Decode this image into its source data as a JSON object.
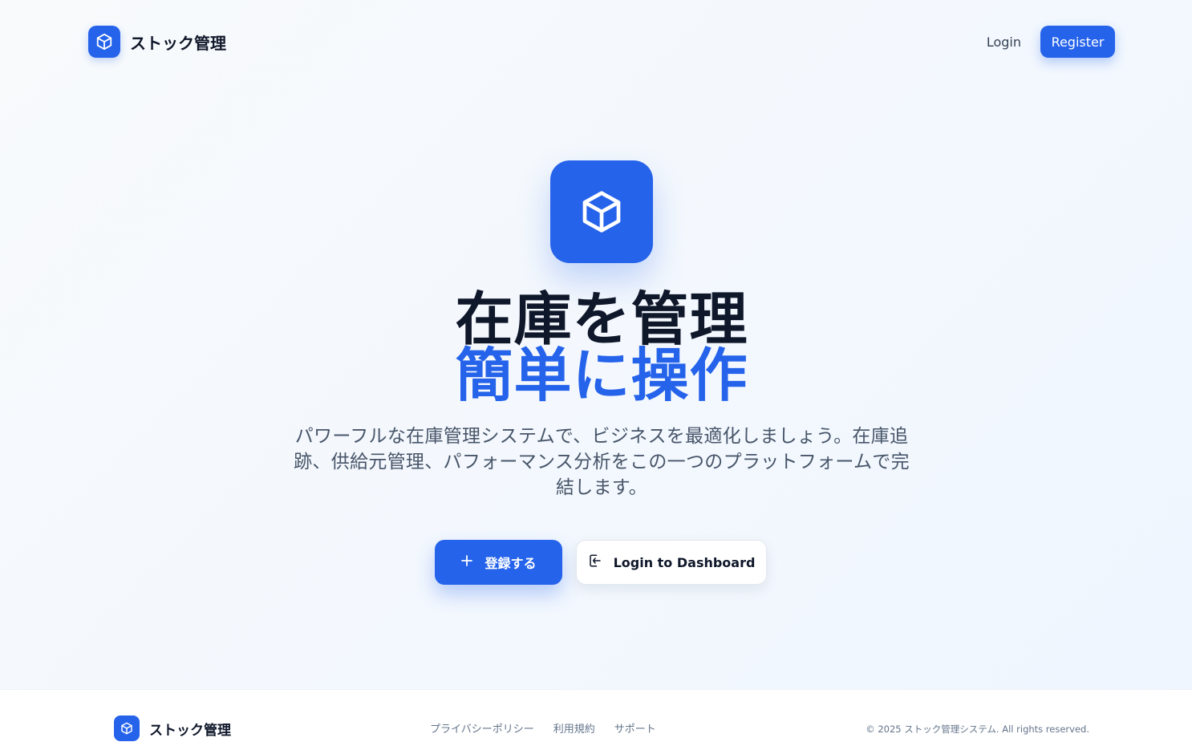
{
  "header": {
    "brand_name": "ストック管理",
    "brand_icon": "cube-icon",
    "login_label": "Login",
    "register_label": "Register"
  },
  "hero": {
    "icon": "cube-icon",
    "title_line1": "在庫を管理",
    "title_line2": "簡単に操作",
    "description": "パワーフルな在庫管理システムで、ビジネスを最適化しましょう。在庫追跡、供給元管理、パフォーマンス分析をこの一つのプラットフォームで完結します。",
    "primary_cta": {
      "icon": "plus-icon",
      "label": "登録する"
    },
    "secondary_cta": {
      "icon": "login-icon",
      "label": "Login to Dashboard"
    }
  },
  "footer": {
    "brand_name": "ストック管理",
    "links": [
      "プライバシーポリシー",
      "利用規約",
      "サポート"
    ],
    "copyright": "© 2025 ストック管理システム. All rights reserved."
  },
  "colors": {
    "accent": "#2563eb",
    "title": "#0f172a",
    "muted": "#475569"
  }
}
